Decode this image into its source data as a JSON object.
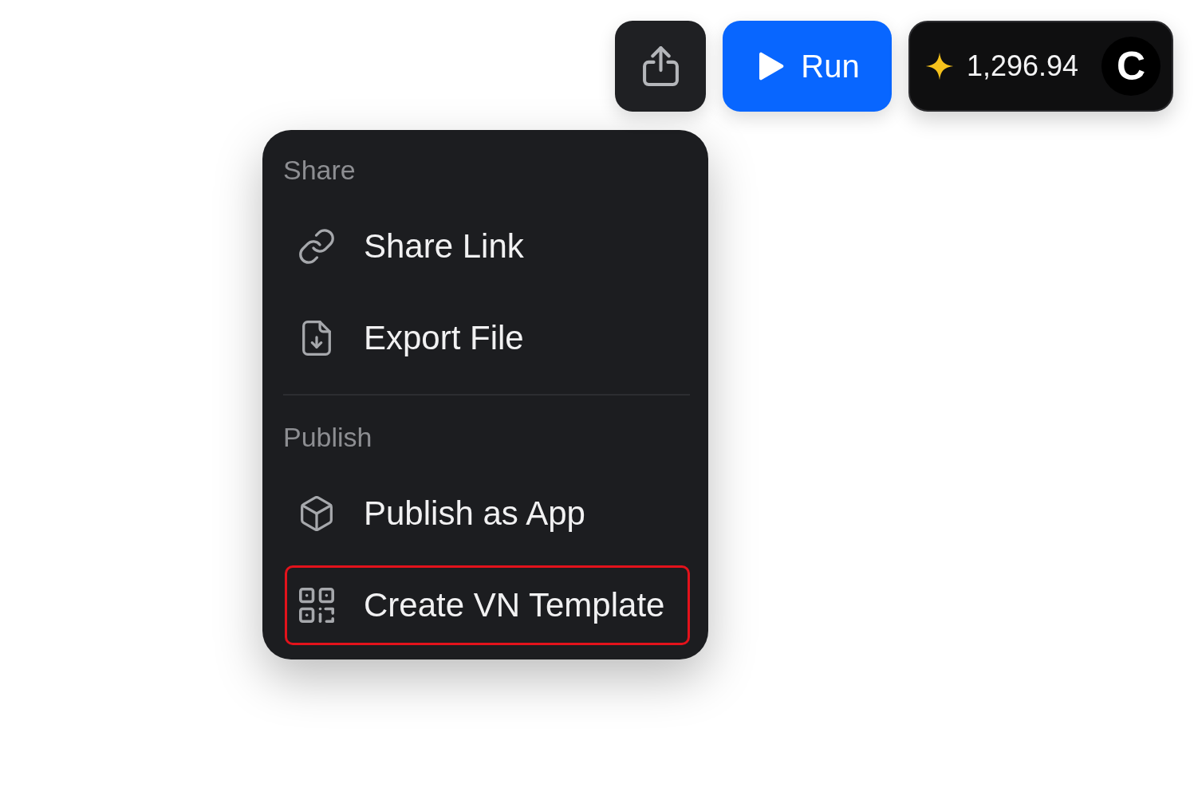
{
  "toolbar": {
    "run_button": {
      "label": "Run"
    },
    "credits": {
      "amount": "1,296.94",
      "avatar_initial": "C"
    }
  },
  "menu": {
    "sections": [
      {
        "title": "Share",
        "items": [
          {
            "kind": "link",
            "label": "Share Link",
            "highlighted": false
          },
          {
            "kind": "export",
            "label": "Export File",
            "highlighted": false
          }
        ]
      },
      {
        "title": "Publish",
        "items": [
          {
            "kind": "app",
            "label": "Publish as App",
            "highlighted": false
          },
          {
            "kind": "template",
            "label": "Create VN Template",
            "highlighted": true
          }
        ]
      }
    ]
  }
}
